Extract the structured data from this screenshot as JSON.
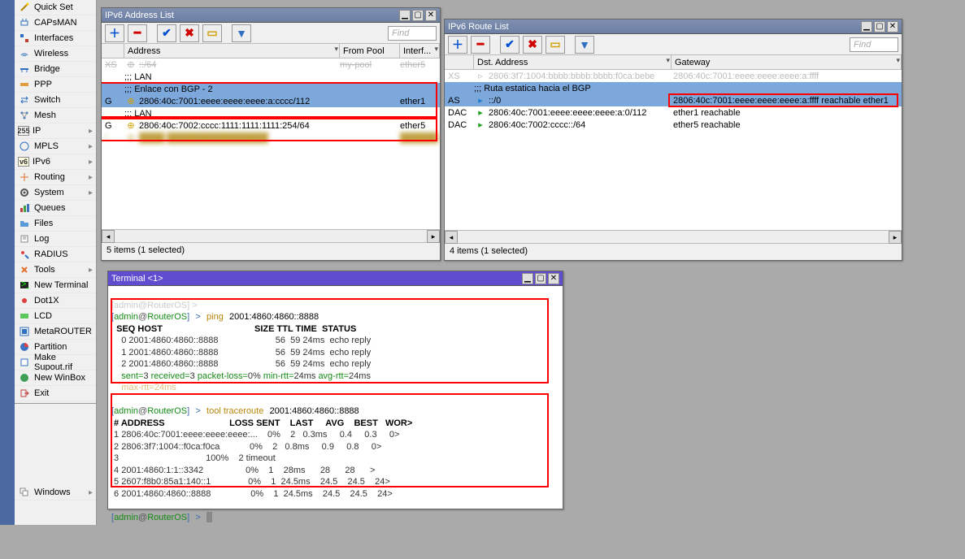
{
  "sidebar": {
    "items": [
      {
        "label": "Quick Set",
        "arrow": false
      },
      {
        "label": "CAPsMAN",
        "arrow": false
      },
      {
        "label": "Interfaces",
        "arrow": false
      },
      {
        "label": "Wireless",
        "arrow": false
      },
      {
        "label": "Bridge",
        "arrow": false
      },
      {
        "label": "PPP",
        "arrow": false
      },
      {
        "label": "Switch",
        "arrow": false
      },
      {
        "label": "Mesh",
        "arrow": false
      },
      {
        "label": "IP",
        "arrow": true
      },
      {
        "label": "MPLS",
        "arrow": true
      },
      {
        "label": "IPv6",
        "arrow": true
      },
      {
        "label": "Routing",
        "arrow": true
      },
      {
        "label": "System",
        "arrow": true
      },
      {
        "label": "Queues",
        "arrow": false
      },
      {
        "label": "Files",
        "arrow": false
      },
      {
        "label": "Log",
        "arrow": false
      },
      {
        "label": "RADIUS",
        "arrow": false
      },
      {
        "label": "Tools",
        "arrow": true
      },
      {
        "label": "New Terminal",
        "arrow": false
      },
      {
        "label": "Dot1X",
        "arrow": false
      },
      {
        "label": "LCD",
        "arrow": false
      },
      {
        "label": "MetaROUTER",
        "arrow": false
      },
      {
        "label": "Partition",
        "arrow": false
      },
      {
        "label": "Make Supout.rif",
        "arrow": false
      },
      {
        "label": "New WinBox",
        "arrow": false
      },
      {
        "label": "Exit",
        "arrow": false
      }
    ],
    "bottom": [
      {
        "label": "Windows",
        "arrow": true
      }
    ]
  },
  "addrWin": {
    "title": "IPv6 Address List",
    "findPlaceholder": "Find",
    "cols": {
      "address": "Address",
      "fromPool": "From Pool",
      "interface": "Interf..."
    },
    "rows": [
      {
        "flag": "XS",
        "comment": null,
        "addr": "::/64",
        "pool": "my-pool",
        "iface": "ether5",
        "strike": true,
        "muted": true
      },
      {
        "comment": ";;; LAN"
      },
      {
        "comment": ";;; Enlace con BGP - 2"
      },
      {
        "flag": "G",
        "addr": "2806:40c:7001:eeee:eeee:eeee:a:cccc/112",
        "pool": "",
        "iface": "ether1",
        "sel": true
      },
      {
        "comment": ";;; LAN"
      },
      {
        "flag": "G",
        "addr": "2806:40c:7002:cccc:1111:1111:1111:254/64",
        "pool": "",
        "iface": "ether5"
      },
      {
        "flag": "I",
        "addr": "",
        "pool": "",
        "iface": "",
        "blurred": true
      }
    ],
    "status": "5 items (1 selected)"
  },
  "routeWin": {
    "title": "IPv6 Route List",
    "findPlaceholder": "Find",
    "cols": {
      "dst": "Dst. Address",
      "gateway": "Gateway"
    },
    "rows": [
      {
        "flag": "XS",
        "dst": "2806:3f7:1004:bbbb:bbbb:bbbb:f0ca:bebe",
        "gw": "2806:40c:7001:eeee:eeee:eeee:a:ffff",
        "muted": true
      },
      {
        "comment": ";;; Ruta estatica hacia el BGP"
      },
      {
        "flag": "AS",
        "dst": "::/0",
        "gw": "2806:40c:7001:eeee:eeee:eeee:a:ffff reachable ether1",
        "sel": true
      },
      {
        "flag": "DAC",
        "dst": "2806:40c:7001:eeee:eeee:eeee:a:0/112",
        "gw": "ether1 reachable"
      },
      {
        "flag": "DAC",
        "dst": "2806:40c:7002:cccc::/64",
        "gw": "ether5 reachable"
      }
    ],
    "status": "4 items (1 selected)"
  },
  "termWin": {
    "title": "Terminal <1>",
    "prompt": {
      "user": "admin",
      "host": "RouterOS"
    },
    "ping": {
      "cmd": "ping",
      "target": "2001:4860:4860::8888",
      "header": "  SEQ HOST                                     SIZE TTL TIME  STATUS",
      "lines": [
        "    0 2001:4860:4860::8888                       56  59 24ms  echo reply",
        "    1 2001:4860:4860::8888                       56  59 24ms  echo reply",
        "    2 2001:4860:4860::8888                       56  59 24ms  echo reply"
      ],
      "summaryPrefix": "    ",
      "sent": "sent=3",
      "recv": "received=3",
      "loss": "packet-loss=0%",
      "minrtt": "min-rtt=24ms",
      "avgrtt": "avg-rtt=24ms",
      "maxrtt": "max-rtt=24ms"
    },
    "trace": {
      "cmd": "tool traceroute",
      "target": "2001:4860:4860::8888",
      "header": " # ADDRESS                          LOSS SENT    LAST     AVG    BEST   WOR>",
      "lines": [
        " 1 2806:40c:7001:eeee:eeee:eeee:...    0%    2   0.3ms     0.4     0.3     0>",
        " 2 2806:3f7:1004::f0ca:f0ca            0%    2   0.8ms     0.9     0.8     0>",
        " 3                                   100%    2 timeout",
        " 4 2001:4860:1:1::3342                 0%    1    28ms      28      28      >",
        " 5 2607:f8b0:85a1:140::1               0%    1  24.5ms    24.5    24.5    24>",
        " 6 2001:4860:4860::8888                0%    1  24.5ms    24.5    24.5    24>"
      ]
    }
  }
}
